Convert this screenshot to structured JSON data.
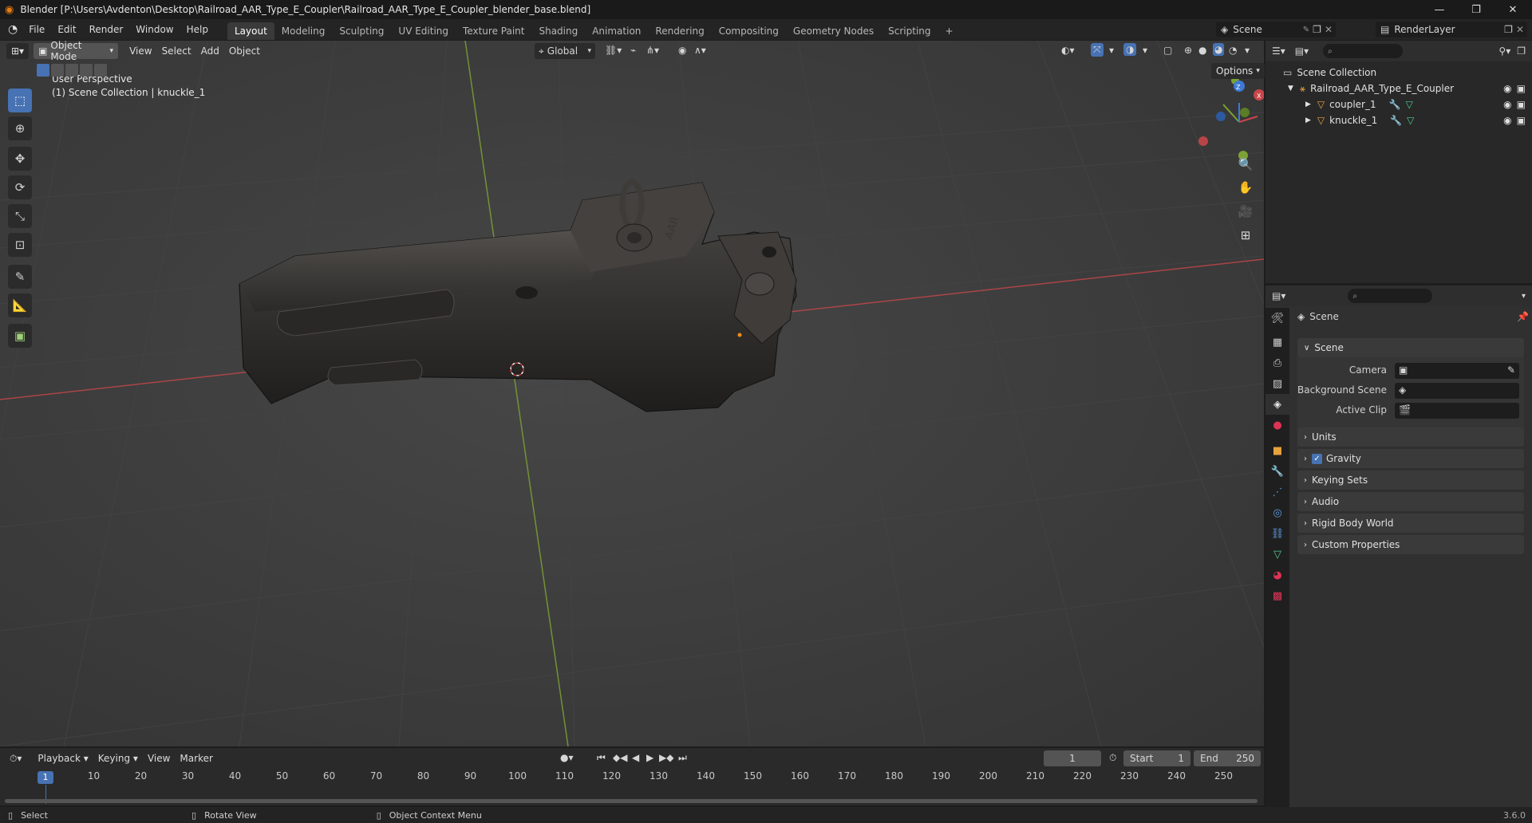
{
  "window": {
    "title": "Blender [P:\\Users\\Avdenton\\Desktop\\Railroad_AAR_Type_E_Coupler\\Railroad_AAR_Type_E_Coupler_blender_base.blend]",
    "minimize": "—",
    "maximize": "❐",
    "close": "✕"
  },
  "menu": {
    "items": [
      "File",
      "Edit",
      "Render",
      "Window",
      "Help"
    ],
    "workspaces": [
      "Layout",
      "Modeling",
      "Sculpting",
      "UV Editing",
      "Texture Paint",
      "Shading",
      "Animation",
      "Rendering",
      "Compositing",
      "Geometry Nodes",
      "Scripting"
    ],
    "active_workspace": "Layout",
    "add_workspace": "+",
    "scene_name": "Scene",
    "render_layer": "RenderLayer"
  },
  "viewport": {
    "mode": "Object Mode",
    "menus": [
      "View",
      "Select",
      "Add",
      "Object"
    ],
    "transform_orientation": "Global",
    "options": "Options",
    "overlay_line1": "User Perspective",
    "overlay_line2": "(1) Scene Collection | knuckle_1",
    "gizmo_axes": {
      "x": "X",
      "y": "Y",
      "z": "Z"
    },
    "object_text": "AAR"
  },
  "outliner": {
    "root": "Scene Collection",
    "collection": "Railroad_AAR_Type_E_Coupler",
    "objects": [
      "coupler_1",
      "knuckle_1"
    ]
  },
  "properties": {
    "header": "Scene",
    "panel": "Scene",
    "fields": [
      {
        "label": "Camera",
        "value": ""
      },
      {
        "label": "Background Scene",
        "value": ""
      },
      {
        "label": "Active Clip",
        "value": ""
      }
    ],
    "sections": [
      "Units",
      "Gravity",
      "Keying Sets",
      "Audio",
      "Rigid Body World",
      "Custom Properties"
    ],
    "gravity_checked": true
  },
  "timeline": {
    "menus": [
      "Playback",
      "Keying",
      "View",
      "Marker"
    ],
    "current_frame": "1",
    "start_label": "Start",
    "start": "1",
    "end_label": "End",
    "end": "250",
    "ruler": [
      "1",
      "10",
      "20",
      "30",
      "40",
      "50",
      "60",
      "70",
      "80",
      "90",
      "100",
      "110",
      "120",
      "130",
      "140",
      "150",
      "160",
      "170",
      "180",
      "190",
      "200",
      "210",
      "220",
      "230",
      "240",
      "250"
    ]
  },
  "status": {
    "hints": [
      "Select",
      "Rotate View",
      "Object Context Menu"
    ],
    "version": "3.6.0"
  },
  "colors": {
    "accent": "#4772b3",
    "x_axis": "#c8464a",
    "y_axis": "#7ba233",
    "z_axis": "#3d7ad6",
    "outliner_active": "#334d80"
  }
}
